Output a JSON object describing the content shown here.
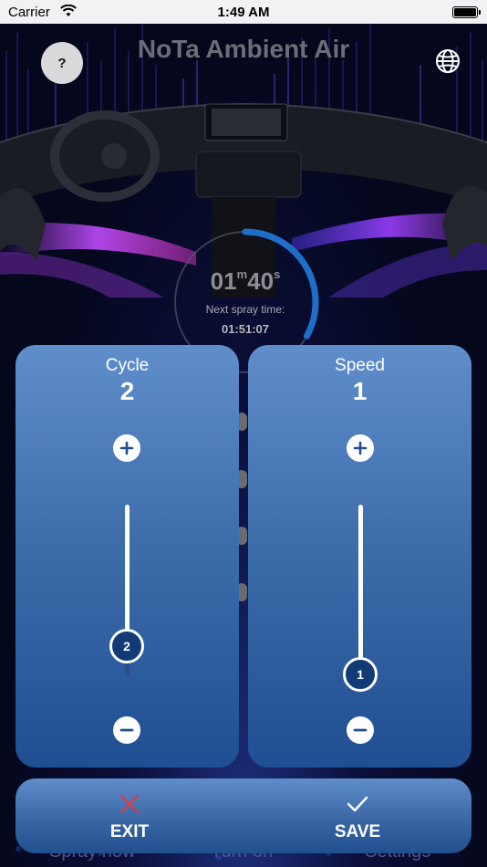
{
  "status_bar": {
    "carrier": "Carrier",
    "time": "1:49 AM"
  },
  "header": {
    "title": "NoTa Ambient Air",
    "help_label": "?"
  },
  "timer": {
    "minutes": "01",
    "minutes_unit": "m",
    "seconds": "40",
    "seconds_unit": "s",
    "next_label": "Next spray time:",
    "next_time": "01:51:07",
    "progress": 0.33
  },
  "cycle_card": {
    "label": "Cycle",
    "value": "2",
    "slider_value": "2",
    "level": 0.25
  },
  "speed_card": {
    "label": "Speed",
    "value": "1",
    "slider_value": "1",
    "level": 0.0
  },
  "actions": {
    "exit_label": "EXIT",
    "save_label": "SAVE"
  },
  "bottom_tabs": {
    "spray_now": "Spray now",
    "turn_on": "Turn on",
    "settings": "Settings"
  },
  "colors": {
    "exit_icon": "#e5383b",
    "card_top": "#5f8ecb",
    "card_bottom": "#1f4f92",
    "thumb": "#123a74"
  }
}
